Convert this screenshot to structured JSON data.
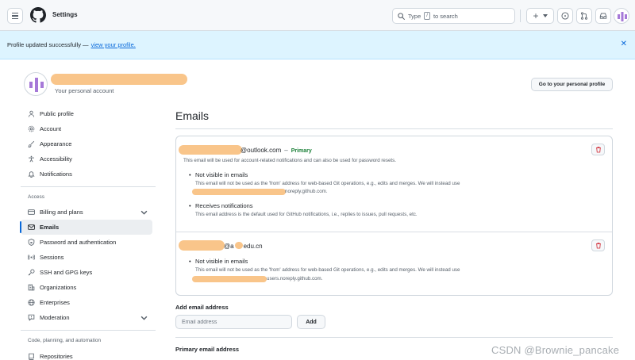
{
  "header": {
    "title": "Settings",
    "search_prefix": "Type",
    "search_key": "/",
    "search_suffix": "to search",
    "new_button_label": "+"
  },
  "flash": {
    "message": "Profile updated successfully —",
    "link": "view your profile."
  },
  "account": {
    "subtitle": "Your personal account",
    "personal_button": "Go to your personal profile"
  },
  "sidebar": {
    "items": [
      {
        "label": "Public profile",
        "icon": "person-icon"
      },
      {
        "label": "Account",
        "icon": "gear-icon"
      },
      {
        "label": "Appearance",
        "icon": "paintbrush-icon"
      },
      {
        "label": "Accessibility",
        "icon": "accessibility-icon"
      },
      {
        "label": "Notifications",
        "icon": "bell-icon"
      }
    ],
    "access_heading": "Access",
    "access_items": [
      {
        "label": "Billing and plans",
        "icon": "credit-card-icon"
      },
      {
        "label": "Emails",
        "icon": "mail-icon"
      },
      {
        "label": "Password and authentication",
        "icon": "shield-lock-icon"
      },
      {
        "label": "Sessions",
        "icon": "broadcast-icon"
      },
      {
        "label": "SSH and GPG keys",
        "icon": "key-icon"
      },
      {
        "label": "Organizations",
        "icon": "organization-icon"
      },
      {
        "label": "Enterprises",
        "icon": "globe-icon"
      },
      {
        "label": "Moderation",
        "icon": "report-icon"
      }
    ],
    "automation_heading": "Code, planning, and automation",
    "automation_items": [
      {
        "label": "Repositories",
        "icon": "repo-icon"
      }
    ]
  },
  "main": {
    "title": "Emails",
    "emails": [
      {
        "address_suffix": "@outlook.com",
        "separator": "–",
        "badge": "Primary",
        "note": "This email will be used for account-related notifications and can also be used for password resets.",
        "bullets": [
          {
            "title": "Not visible in emails",
            "text": "This email will not be used as the 'from' address for web-based Git operations, e.g., edits and merges. We will instead use",
            "text2": "noreply.github.com."
          },
          {
            "title": "Receives notifications",
            "text": "This email address is the default used for GitHub notifications, i.e., replies to issues, pull requests, etc."
          }
        ]
      },
      {
        "address_suffix": "@a",
        "address_suffix2": "edu.cn",
        "bullets": [
          {
            "title": "Not visible in emails",
            "text": "This email will not be used as the 'from' address for web-based Git operations, e.g., edits and merges. We will instead use",
            "text2": "users.noreply.github.com."
          }
        ]
      }
    ],
    "add_label": "Add email address",
    "add_placeholder": "Email address",
    "add_button": "Add",
    "primary_label": "Primary email address"
  },
  "watermark": "CSDN @Brownie_pancake",
  "colors": {
    "accent": "#0969da",
    "primary_badge": "#1a7f37",
    "danger": "#cf222e",
    "flash_bg": "#ddf4ff",
    "redaction": "#f9c58a"
  }
}
